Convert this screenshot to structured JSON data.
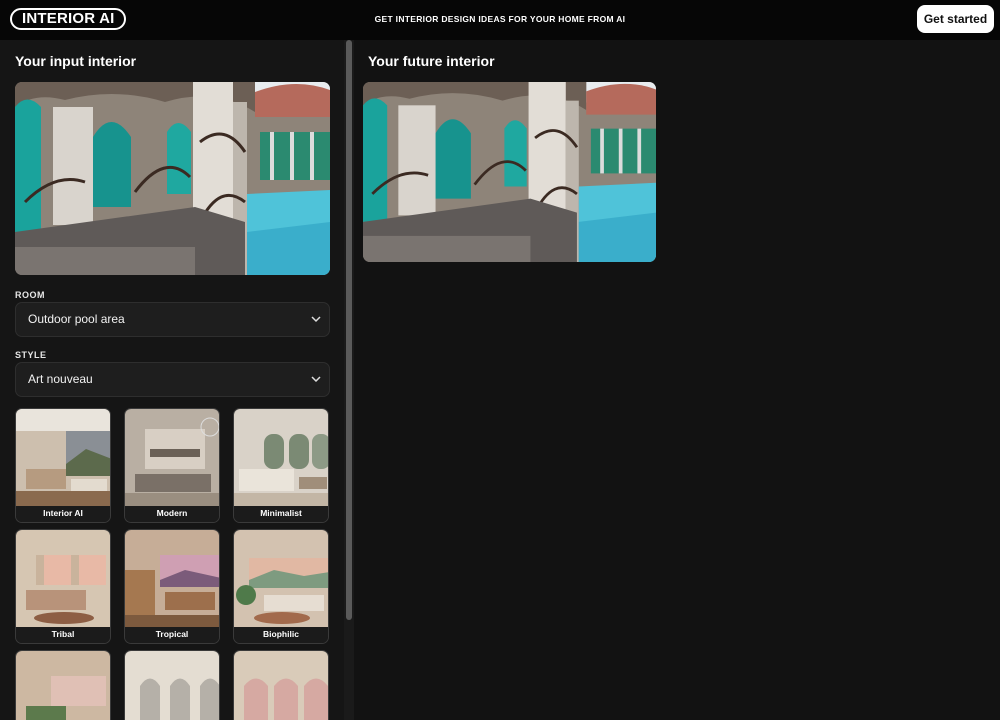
{
  "header": {
    "logo": "INTERIOR AI",
    "tagline": "GET INTERIOR DESIGN IDEAS FOR YOUR HOME FROM AI",
    "cta_label": "Get started"
  },
  "input_section": {
    "title": "Your input interior",
    "room_label": "ROOM",
    "room_value": "Outdoor pool area",
    "style_label": "STYLE",
    "style_value": "Art nouveau"
  },
  "output_section": {
    "title": "Your future interior"
  },
  "styles": [
    {
      "label": "Interior AI"
    },
    {
      "label": "Modern"
    },
    {
      "label": "Minimalist"
    },
    {
      "label": "Tribal"
    },
    {
      "label": "Tropical"
    },
    {
      "label": "Biophilic"
    },
    {
      "label": ""
    },
    {
      "label": ""
    },
    {
      "label": ""
    }
  ],
  "icons": {
    "select_chevron": "chevron-down-icon"
  },
  "colors": {
    "background": "#111111",
    "topbar": "#060606",
    "accent_button": "#ffffff",
    "pool_water": "#4fc3d9",
    "stained_glass": "#1aa39c"
  }
}
